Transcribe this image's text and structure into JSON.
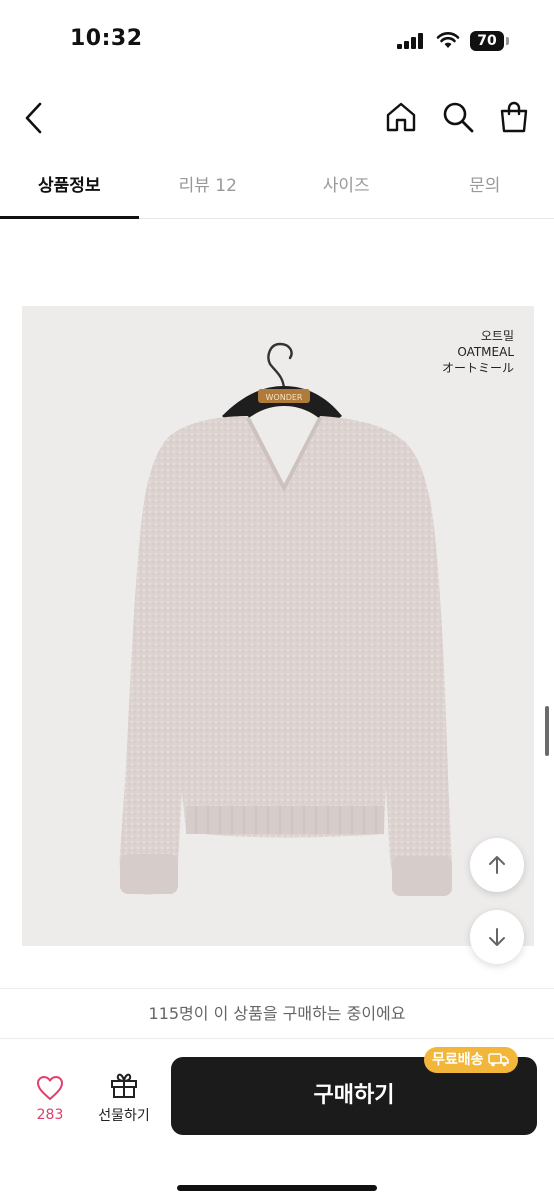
{
  "status_bar": {
    "time": "10:32",
    "battery": "70"
  },
  "tabs": [
    {
      "label": "상품정보",
      "active": true
    },
    {
      "label": "리뷰 12",
      "active": false
    },
    {
      "label": "사이즈",
      "active": false
    },
    {
      "label": "문의",
      "active": false
    }
  ],
  "product_image": {
    "color_label": {
      "ko": "오트밀",
      "en": "OATMEAL",
      "jp": "オートミール"
    },
    "hanger_text": "WONDER"
  },
  "notice": "115명이 이 상품을 구매하는 중이에요",
  "bottom_bar": {
    "like_count": "283",
    "gift_label": "선물하기",
    "buy_label": "구매하기",
    "badge_label": "무료배송"
  },
  "icons": [
    "back-icon",
    "home-icon",
    "search-icon",
    "bag-icon",
    "heart-icon",
    "gift-icon",
    "arrow-up-icon",
    "arrow-down-icon",
    "truck-icon"
  ],
  "colors": {
    "accent": "#e0406a",
    "buy_button": "#1b1b1b",
    "badge": "#f2b73a",
    "image_bg": "#eeeceb"
  }
}
